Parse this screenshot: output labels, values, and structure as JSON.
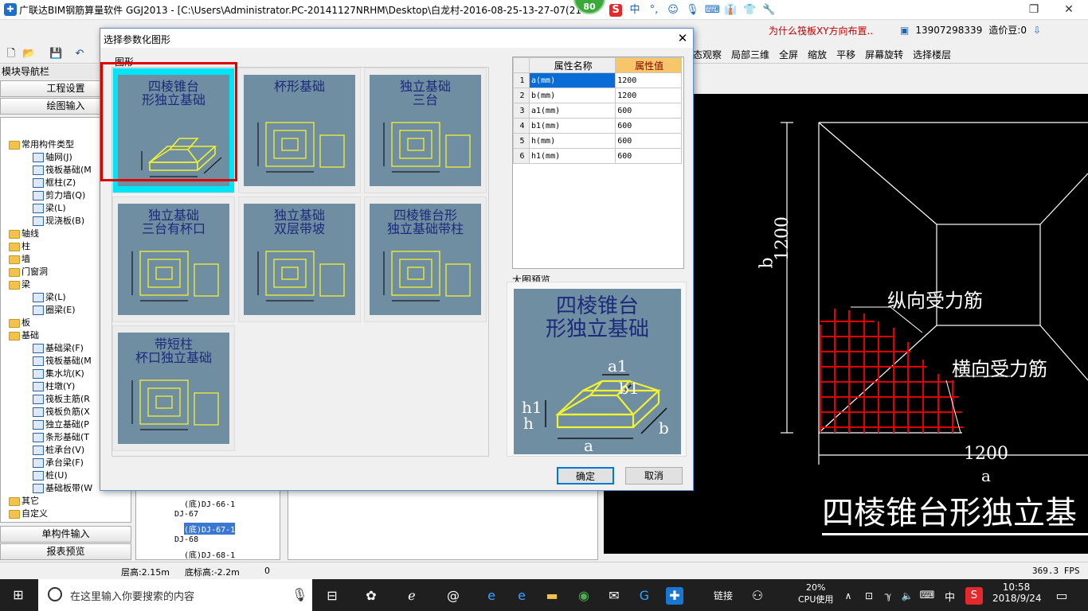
{
  "window": {
    "app_title": "广联达BIM钢筋算量软件 GGJ2013 - [C:\\Users\\Administrator.PC-20141127NRHM\\Desktop\\白龙村-2016-08-25-13-27-07(218...",
    "badge": "80",
    "news": "为什么筏板XY方向布置..",
    "phone": "13907298339",
    "beans": "造价豆:0"
  },
  "toolbar": {
    "items": [
      "态观察",
      "局部三维",
      "全屏",
      "缩放",
      "平移",
      "屏幕旋转",
      "选择楼层"
    ]
  },
  "nav": {
    "header": "模块导航栏",
    "project_settings": "工程设置",
    "drawing_input": "绘图输入",
    "single_input": "单构件输入",
    "report_preview": "报表预览",
    "tree": [
      {
        "label": "常用构件类型",
        "kind": "folder",
        "level": 1
      },
      {
        "label": "轴网(J)",
        "kind": "comp",
        "level": 2
      },
      {
        "label": "筏板基础(M",
        "kind": "comp",
        "level": 2
      },
      {
        "label": "框柱(Z)",
        "kind": "comp",
        "level": 2
      },
      {
        "label": "剪力墙(Q)",
        "kind": "comp",
        "level": 2
      },
      {
        "label": "梁(L)",
        "kind": "comp",
        "level": 2
      },
      {
        "label": "现浇板(B)",
        "kind": "comp",
        "level": 2
      },
      {
        "label": "轴线",
        "kind": "folder",
        "level": 1
      },
      {
        "label": "柱",
        "kind": "folder",
        "level": 1
      },
      {
        "label": "墙",
        "kind": "folder",
        "level": 1
      },
      {
        "label": "门窗洞",
        "kind": "folder",
        "level": 1
      },
      {
        "label": "梁",
        "kind": "folder",
        "level": 1
      },
      {
        "label": "梁(L)",
        "kind": "comp",
        "level": 2
      },
      {
        "label": "圈梁(E)",
        "kind": "comp",
        "level": 2
      },
      {
        "label": "板",
        "kind": "folder",
        "level": 1
      },
      {
        "label": "基础",
        "kind": "folder",
        "level": 1
      },
      {
        "label": "基础梁(F)",
        "kind": "comp",
        "level": 2
      },
      {
        "label": "筏板基础(M",
        "kind": "comp",
        "level": 2
      },
      {
        "label": "集水坑(K)",
        "kind": "comp",
        "level": 2
      },
      {
        "label": "柱墩(Y)",
        "kind": "comp",
        "level": 2
      },
      {
        "label": "筏板主筋(R",
        "kind": "comp",
        "level": 2
      },
      {
        "label": "筏板负筋(X",
        "kind": "comp",
        "level": 2
      },
      {
        "label": "独立基础(P",
        "kind": "comp",
        "level": 2
      },
      {
        "label": "条形基础(T",
        "kind": "comp",
        "level": 2
      },
      {
        "label": "桩承台(V)",
        "kind": "comp",
        "level": 2
      },
      {
        "label": "承台梁(F)",
        "kind": "comp",
        "level": 2
      },
      {
        "label": "桩(U)",
        "kind": "comp",
        "level": 2
      },
      {
        "label": "基础板带(W",
        "kind": "comp",
        "level": 2
      },
      {
        "label": "其它",
        "kind": "folder",
        "level": 1
      },
      {
        "label": "自定义",
        "kind": "folder",
        "level": 1
      }
    ]
  },
  "tree2": [
    {
      "label": "(底)DJ-66-1",
      "level": 2
    },
    {
      "label": "DJ-67",
      "level": 1
    },
    {
      "label": "(底)DJ-67-1",
      "level": 2,
      "selected": true
    },
    {
      "label": "DJ-68",
      "level": 1
    },
    {
      "label": "(底)DJ-68-1",
      "level": 2
    }
  ],
  "dialog": {
    "title": "选择参数化图形",
    "group_label": "图形",
    "shapes": [
      {
        "caption": "四棱锥台\n形独立基础",
        "selected": true
      },
      {
        "caption": "杯形基础"
      },
      {
        "caption": "独立基础\n三台"
      },
      {
        "caption": "独立基础\n三台有杯口"
      },
      {
        "caption": "独立基础\n双层带坡"
      },
      {
        "caption": "四棱锥台形\n独立基础带柱"
      },
      {
        "caption": "带短柱\n杯口独立基础"
      }
    ],
    "prop_header_name": "属性名称",
    "prop_header_value": "属性值",
    "properties": [
      {
        "no": "1",
        "name": "a(mm)",
        "value": "1200"
      },
      {
        "no": "2",
        "name": "b(mm)",
        "value": "1200"
      },
      {
        "no": "3",
        "name": "a1(mm)",
        "value": "600"
      },
      {
        "no": "4",
        "name": "b1(mm)",
        "value": "600"
      },
      {
        "no": "5",
        "name": "h(mm)",
        "value": "600"
      },
      {
        "no": "6",
        "name": "h1(mm)",
        "value": "600"
      }
    ],
    "preview_label": "大图预览",
    "preview_caption": "四棱锥台\n形独立基础",
    "ok": "确定",
    "cancel": "取消"
  },
  "cad": {
    "dim_b_value": "1200",
    "dim_b_label": "b",
    "dim_a_value": "1200",
    "dim_a_label": "a",
    "label_long": "纵向受力筋",
    "label_trans": "横向受力筋",
    "title": "四棱锥台形独立基"
  },
  "status": {
    "floor_height": "层高:2.15m",
    "bottom_elev": "底标高:-2.2m",
    "zero": "0",
    "fps": "369.3 FPS"
  },
  "taskbar": {
    "search_placeholder": "在这里输入你要搜索的内容",
    "link": "链接",
    "cpu_pct": "20%",
    "cpu_label": "CPU使用",
    "lang": "中",
    "time": "10:58",
    "date": "2018/9/24"
  }
}
